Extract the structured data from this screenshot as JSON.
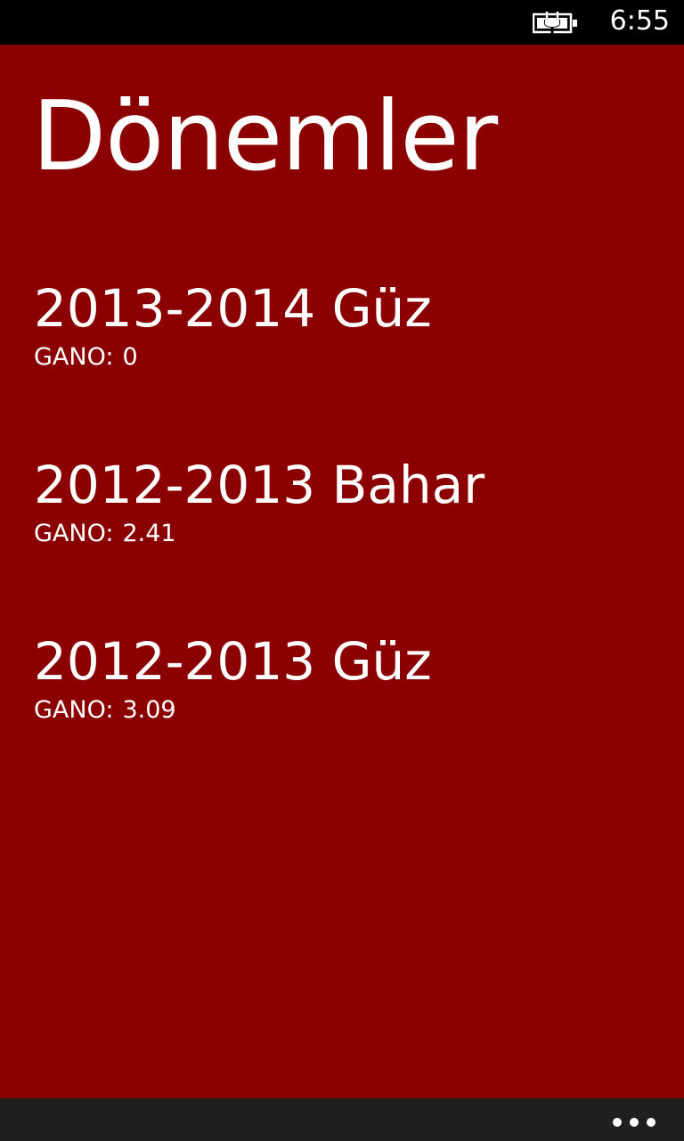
{
  "status_bar": {
    "time": "6:55",
    "battery_icon": "battery-charging-icon"
  },
  "page": {
    "title": "Dönemler",
    "background_color": "#8b0000"
  },
  "semesters": [
    {
      "name": "2013-2014 Güz",
      "gpa_label": "GANO:",
      "gpa_value": "0"
    },
    {
      "name": "2012-2013 Bahar",
      "gpa_label": "GANO:",
      "gpa_value": "2.41"
    },
    {
      "name": "2012-2013 Güz",
      "gpa_label": "GANO:",
      "gpa_value": "3.09"
    }
  ],
  "app_bar": {
    "more_icon": "ellipsis-icon"
  }
}
